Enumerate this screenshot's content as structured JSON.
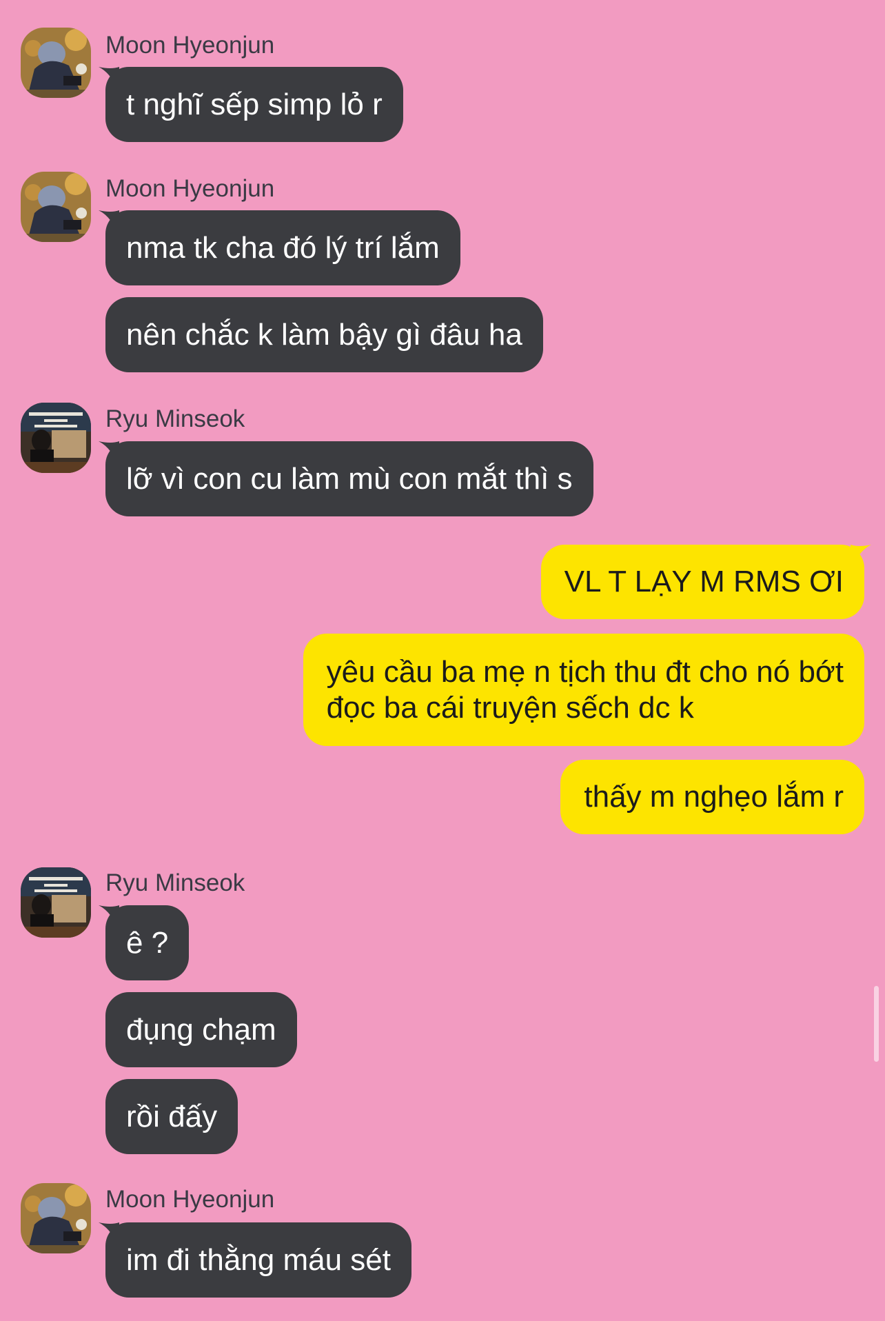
{
  "colors": {
    "background": "#f29bc1",
    "incoming_bubble": "#3b3c40",
    "outgoing_bubble": "#fde400"
  },
  "messages": {
    "g1": {
      "sender": "Moon Hyeonjun",
      "avatar": "avatar-moon-hyeonjun",
      "m1": "t nghĩ sếp simp lỏ r"
    },
    "g2": {
      "sender": "Moon Hyeonjun",
      "avatar": "avatar-moon-hyeonjun",
      "m1": "nma tk cha đó lý trí lắm",
      "m2": "nên chắc k làm bậy gì đâu ha"
    },
    "g3": {
      "sender": "Ryu Minseok",
      "avatar": "avatar-ryu-minseok",
      "m1": "lỡ vì con cu làm mù con mắt thì s"
    },
    "g4": {
      "m1": "VL T LẠY M RMS ƠI",
      "m2_line1": "yêu cầu ba mẹ n tịch thu đt cho nó bớt",
      "m2_line2": "đọc ba cái truyện sếch dc k",
      "m3": "thấy m nghẹo lắm r"
    },
    "g5": {
      "sender": "Ryu Minseok",
      "avatar": "avatar-ryu-minseok",
      "m1": "ê ?",
      "m2": "đụng chạm",
      "m3": "rồi đấy"
    },
    "g6": {
      "sender": "Moon Hyeonjun",
      "avatar": "avatar-moon-hyeonjun",
      "m1": "im đi thằng máu sét"
    }
  }
}
